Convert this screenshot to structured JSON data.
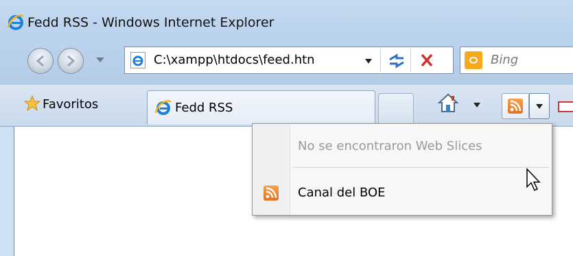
{
  "window": {
    "title": "Fedd RSS - Windows Internet Explorer"
  },
  "address_bar": {
    "value": "C:\\xampp\\htdocs\\feed.htn"
  },
  "search": {
    "placeholder": "Bing"
  },
  "favorites_bar": {
    "favorites_label": "Favoritos"
  },
  "tabs": [
    {
      "label": "Fedd RSS",
      "active": true
    }
  ],
  "feed_menu": {
    "disabled_item": "No se encontraron Web Slices",
    "items": [
      {
        "label": "Canal del BOE",
        "icon": "rss-feed-icon"
      }
    ]
  },
  "colors": {
    "chrome_blue": "#cfe0f3",
    "feed_orange": "#e8701a",
    "stop_red": "#d32f2f"
  }
}
